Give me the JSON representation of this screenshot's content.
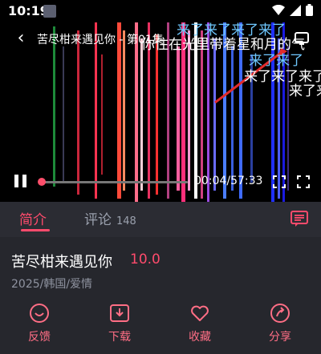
{
  "status": {
    "time": "10:19"
  },
  "player": {
    "title": "苦尽柑来遇见你 - 第01集",
    "danmaku": [
      "来了来了来了来了",
      "你住在光里带着星和月的气",
      "来了来了",
      "来了来了来了来",
      "来了来了"
    ],
    "current_time": "00:04",
    "duration": "57:33",
    "progress": 0.0012
  },
  "tabs": {
    "intro": "简介",
    "comments": "评论",
    "comment_count": "148"
  },
  "info": {
    "title": "苦尽柑来遇见你",
    "score": "10.0",
    "meta": "2025/韩国/爱情"
  },
  "actions": [
    {
      "label": "反馈",
      "icon": "feedback-icon"
    },
    {
      "label": "下载",
      "icon": "download-icon"
    },
    {
      "label": "收藏",
      "icon": "heart-icon"
    },
    {
      "label": "分享",
      "icon": "share-icon"
    }
  ],
  "colors": {
    "accent": "#ff4b6c",
    "background": "#26272d"
  }
}
